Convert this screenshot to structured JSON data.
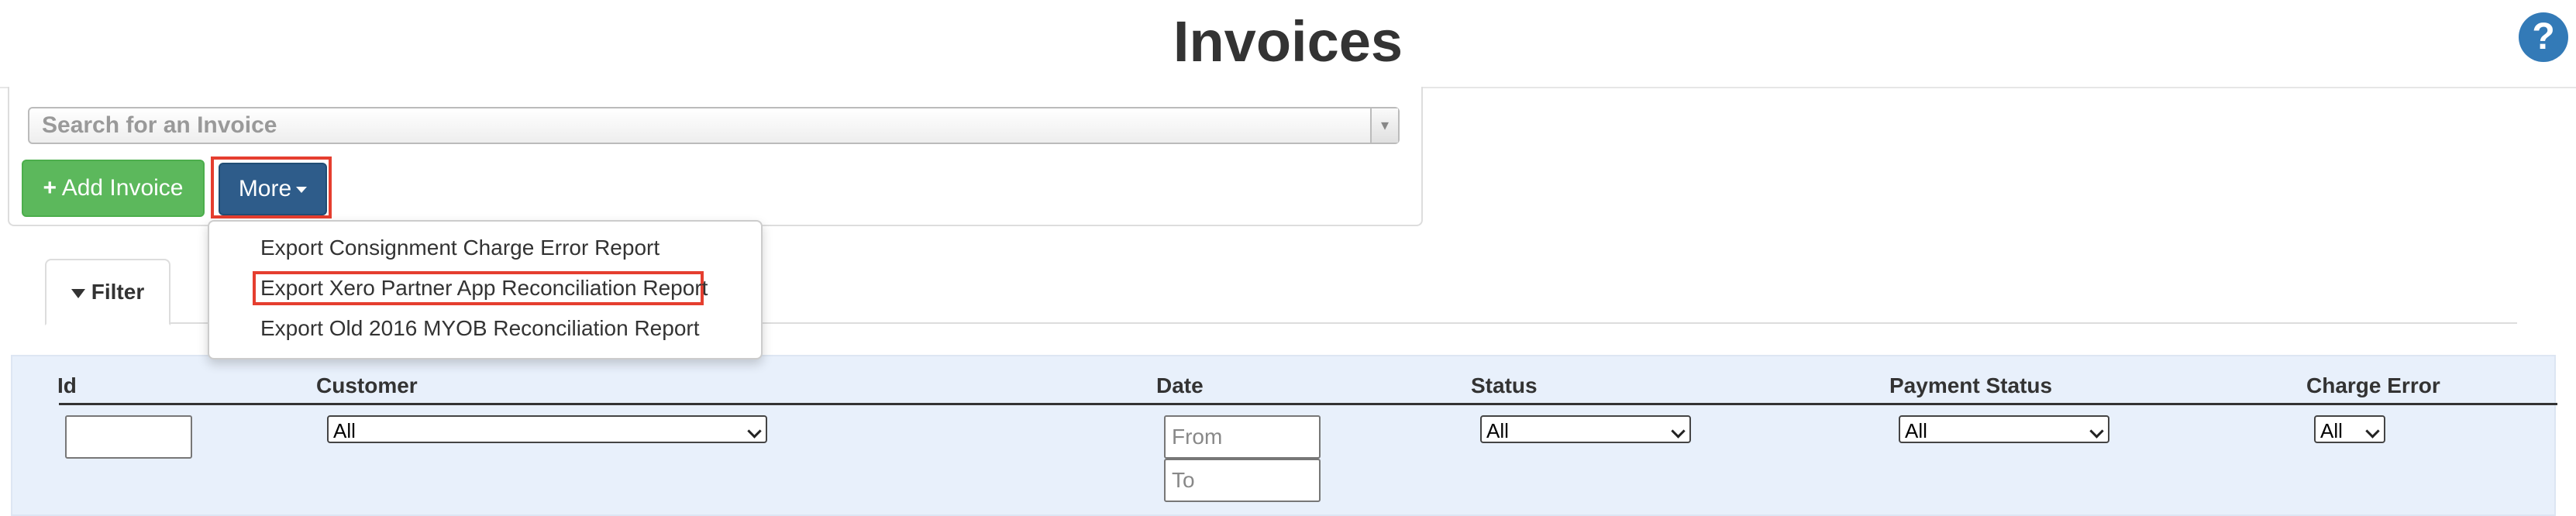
{
  "header": {
    "title": "Invoices",
    "help_icon": "question-circle-icon",
    "help_glyph": "?"
  },
  "search": {
    "placeholder": "Search for an Invoice"
  },
  "actions": {
    "add_label": "Add Invoice",
    "add_icon": "plus-icon",
    "add_glyph": "+",
    "more_label": "More"
  },
  "more_menu": {
    "items": [
      "Export Consignment Charge Error Report",
      "Export Xero Partner App Reconciliation Report",
      "Export Old 2016 MYOB Reconciliation Report"
    ]
  },
  "tabs": {
    "filter_label": "Filter",
    "filter_icon": "funnel-icon"
  },
  "filter": {
    "columns": {
      "id": "Id",
      "customer": "Customer",
      "date": "Date",
      "status": "Status",
      "payment_status": "Payment Status",
      "charge_error": "Charge Error"
    },
    "customer_value": "All",
    "date_from_placeholder": "From",
    "date_to_placeholder": "To",
    "status_value": "All",
    "payment_status_value": "All",
    "charge_error_value": "All"
  },
  "colors": {
    "primary": "#337ab7",
    "success": "#5cb85c",
    "more_button": "#2e5c8a",
    "highlight_outline": "#e53e2f",
    "filter_background": "#e8f0fb"
  }
}
